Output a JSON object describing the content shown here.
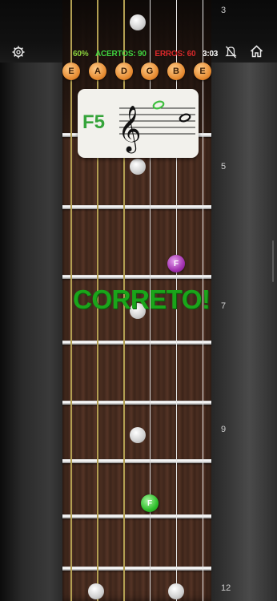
{
  "toolbar": {
    "settings_icon": "gear-icon",
    "mute_icon": "bell-slash-icon",
    "home_icon": "home-icon"
  },
  "stats": {
    "percentage": "60%",
    "hits": "ACERTOS: 90",
    "misses": "ERROS: 60",
    "timer": "3:03"
  },
  "strings": [
    "E",
    "A",
    "D",
    "G",
    "B",
    "E"
  ],
  "fret_numbers": {
    "top": "3",
    "f5": "5",
    "f7": "7",
    "f9": "9",
    "f12": "12"
  },
  "card": {
    "note_name": "F5"
  },
  "markers": {
    "purple_note": "F",
    "green_note": "F"
  },
  "feedback": "CORRETO!",
  "colors": {
    "correct": "#1aa51a",
    "misses": "#d8282a",
    "hits": "#3fd33f",
    "string_head": "#e58a30",
    "answer_marker": "#a232b0",
    "correct_marker": "#2fbf2c"
  }
}
